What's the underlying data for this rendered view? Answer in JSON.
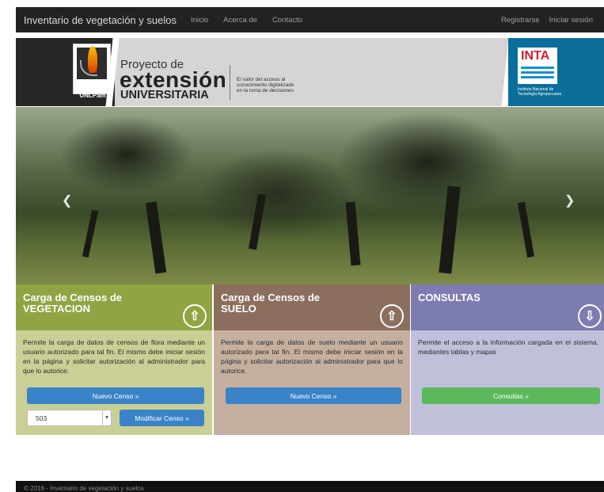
{
  "navbar": {
    "brand": "Inventario de vegetación y suelos",
    "links": [
      "Inicio",
      "Acerca de",
      "Contacto"
    ],
    "right_links": [
      "Registrarse",
      "Iniciar sesión"
    ]
  },
  "banner": {
    "unlpam_label": "UNLPam",
    "project_line1": "Proyecto de",
    "project_line2": "extensión",
    "project_line3": "UNIVERSITARIA",
    "tagline": "El valor del acceso al conocimiento digitalizado en la toma de decisiones",
    "inta_label": "INTA",
    "inta_sub": "Instituto Nacional de Tecnología Agropecuaria"
  },
  "carousel": {
    "prev_icon": "chevron-left-icon",
    "next_icon": "chevron-right-icon"
  },
  "panels": [
    {
      "title": "Carga de Censos de VEGETACION",
      "icon": "arrow-up-icon",
      "text": "Permite la carga de datos de censos de flora mediante un usuario autorizado para tal fin. El mismo debe iniciar sesión en la página y solicitar autorización al administrador para que lo autorice.",
      "button": "Nuevo Censo »",
      "select_value": "503",
      "modify_button": "Modificar Censo »",
      "head_color": "#8fa544",
      "body_color": "#c9cf95"
    },
    {
      "title": "Carga de Censos de SUELO",
      "icon": "arrow-up-icon",
      "text": "Permite la carga de datos de suelo mediante un usuario autorizado para tal fin. El mismo debe iniciar sesión en la página y solicitar autorización al administrador para que lo autorice.",
      "button": "Nuevo Censo »",
      "head_color": "#8b6e5d",
      "body_color": "#c5b09f"
    },
    {
      "title": "CONSULTAS",
      "icon": "arrow-down-icon",
      "text": "Permite el acceso a la información cargada en el sistema, mediantes tablas y mapas",
      "button": "Consultas »",
      "head_color": "#7d7cb0",
      "body_color": "#bfc0da"
    }
  ],
  "footer": {
    "text": "© 2016 - Inventario de vegetación y suelos"
  }
}
